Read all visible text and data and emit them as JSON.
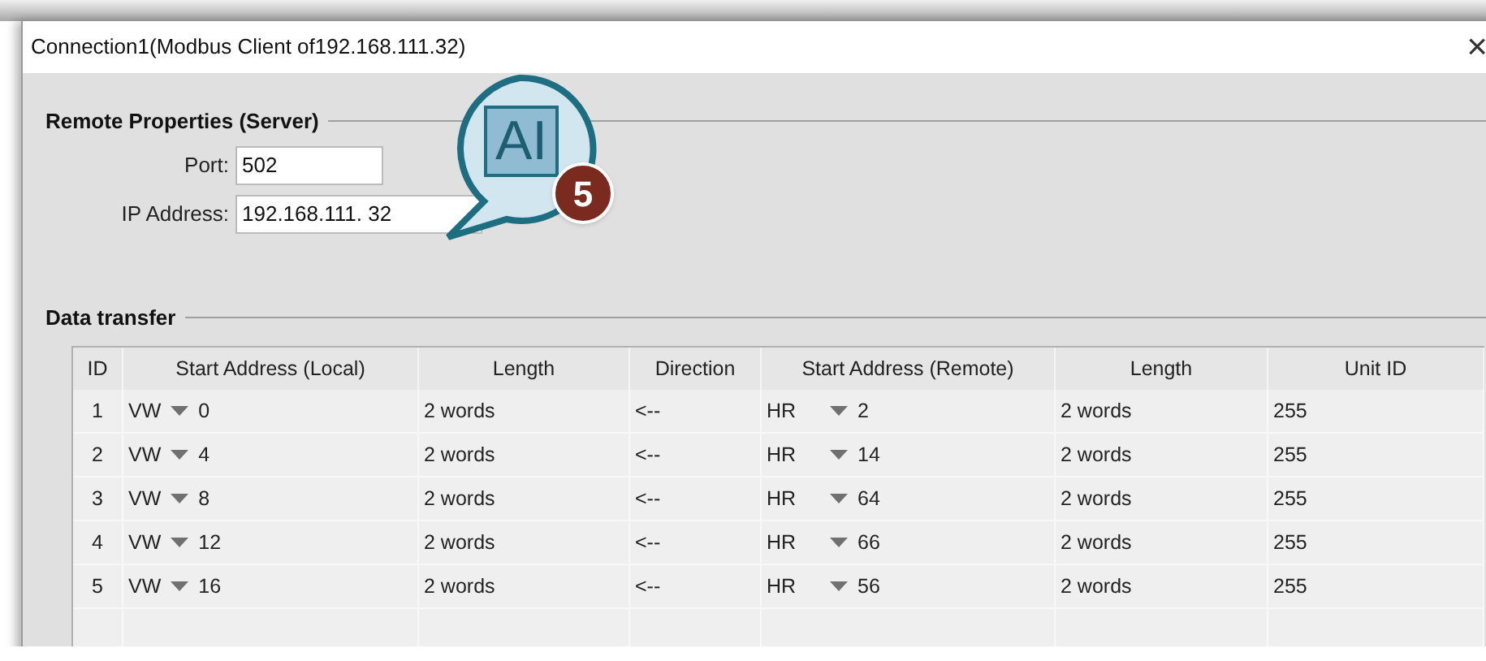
{
  "window": {
    "title": "Connection1(Modbus Client of192.168.111.32)",
    "close": "×"
  },
  "remote_properties": {
    "title": "Remote Properties (Server)",
    "port": {
      "label": "Port:",
      "value": "502"
    },
    "ip_address": {
      "label": "IP Address:",
      "value": "192.168.111. 32"
    }
  },
  "callout": {
    "label": "AI",
    "badge": "5"
  },
  "data_transfer": {
    "title": "Data transfer",
    "columns": [
      "ID",
      "Start Address (Local)",
      "Length",
      "Direction",
      "Start Address (Remote)",
      "Length",
      "Unit ID"
    ],
    "rows": [
      {
        "id": "1",
        "local_area": "VW",
        "local_address": "0",
        "length": "2 words",
        "direction": "<--",
        "remote_area": "HR",
        "remote_address": "2",
        "remote_length": "2 words",
        "unit_id": "255"
      },
      {
        "id": "2",
        "local_area": "VW",
        "local_address": "4",
        "length": "2 words",
        "direction": "<--",
        "remote_area": "HR",
        "remote_address": "14",
        "remote_length": "2 words",
        "unit_id": "255"
      },
      {
        "id": "3",
        "local_area": "VW",
        "local_address": "8",
        "length": "2 words",
        "direction": "<--",
        "remote_area": "HR",
        "remote_address": "64",
        "remote_length": "2 words",
        "unit_id": "255"
      },
      {
        "id": "4",
        "local_area": "VW",
        "local_address": "12",
        "length": "2 words",
        "direction": "<--",
        "remote_area": "HR",
        "remote_address": "66",
        "remote_length": "2 words",
        "unit_id": "255"
      },
      {
        "id": "5",
        "local_area": "VW",
        "local_address": "16",
        "length": "2 words",
        "direction": "<--",
        "remote_area": "HR",
        "remote_address": "56",
        "remote_length": "2 words",
        "unit_id": "255"
      }
    ]
  }
}
